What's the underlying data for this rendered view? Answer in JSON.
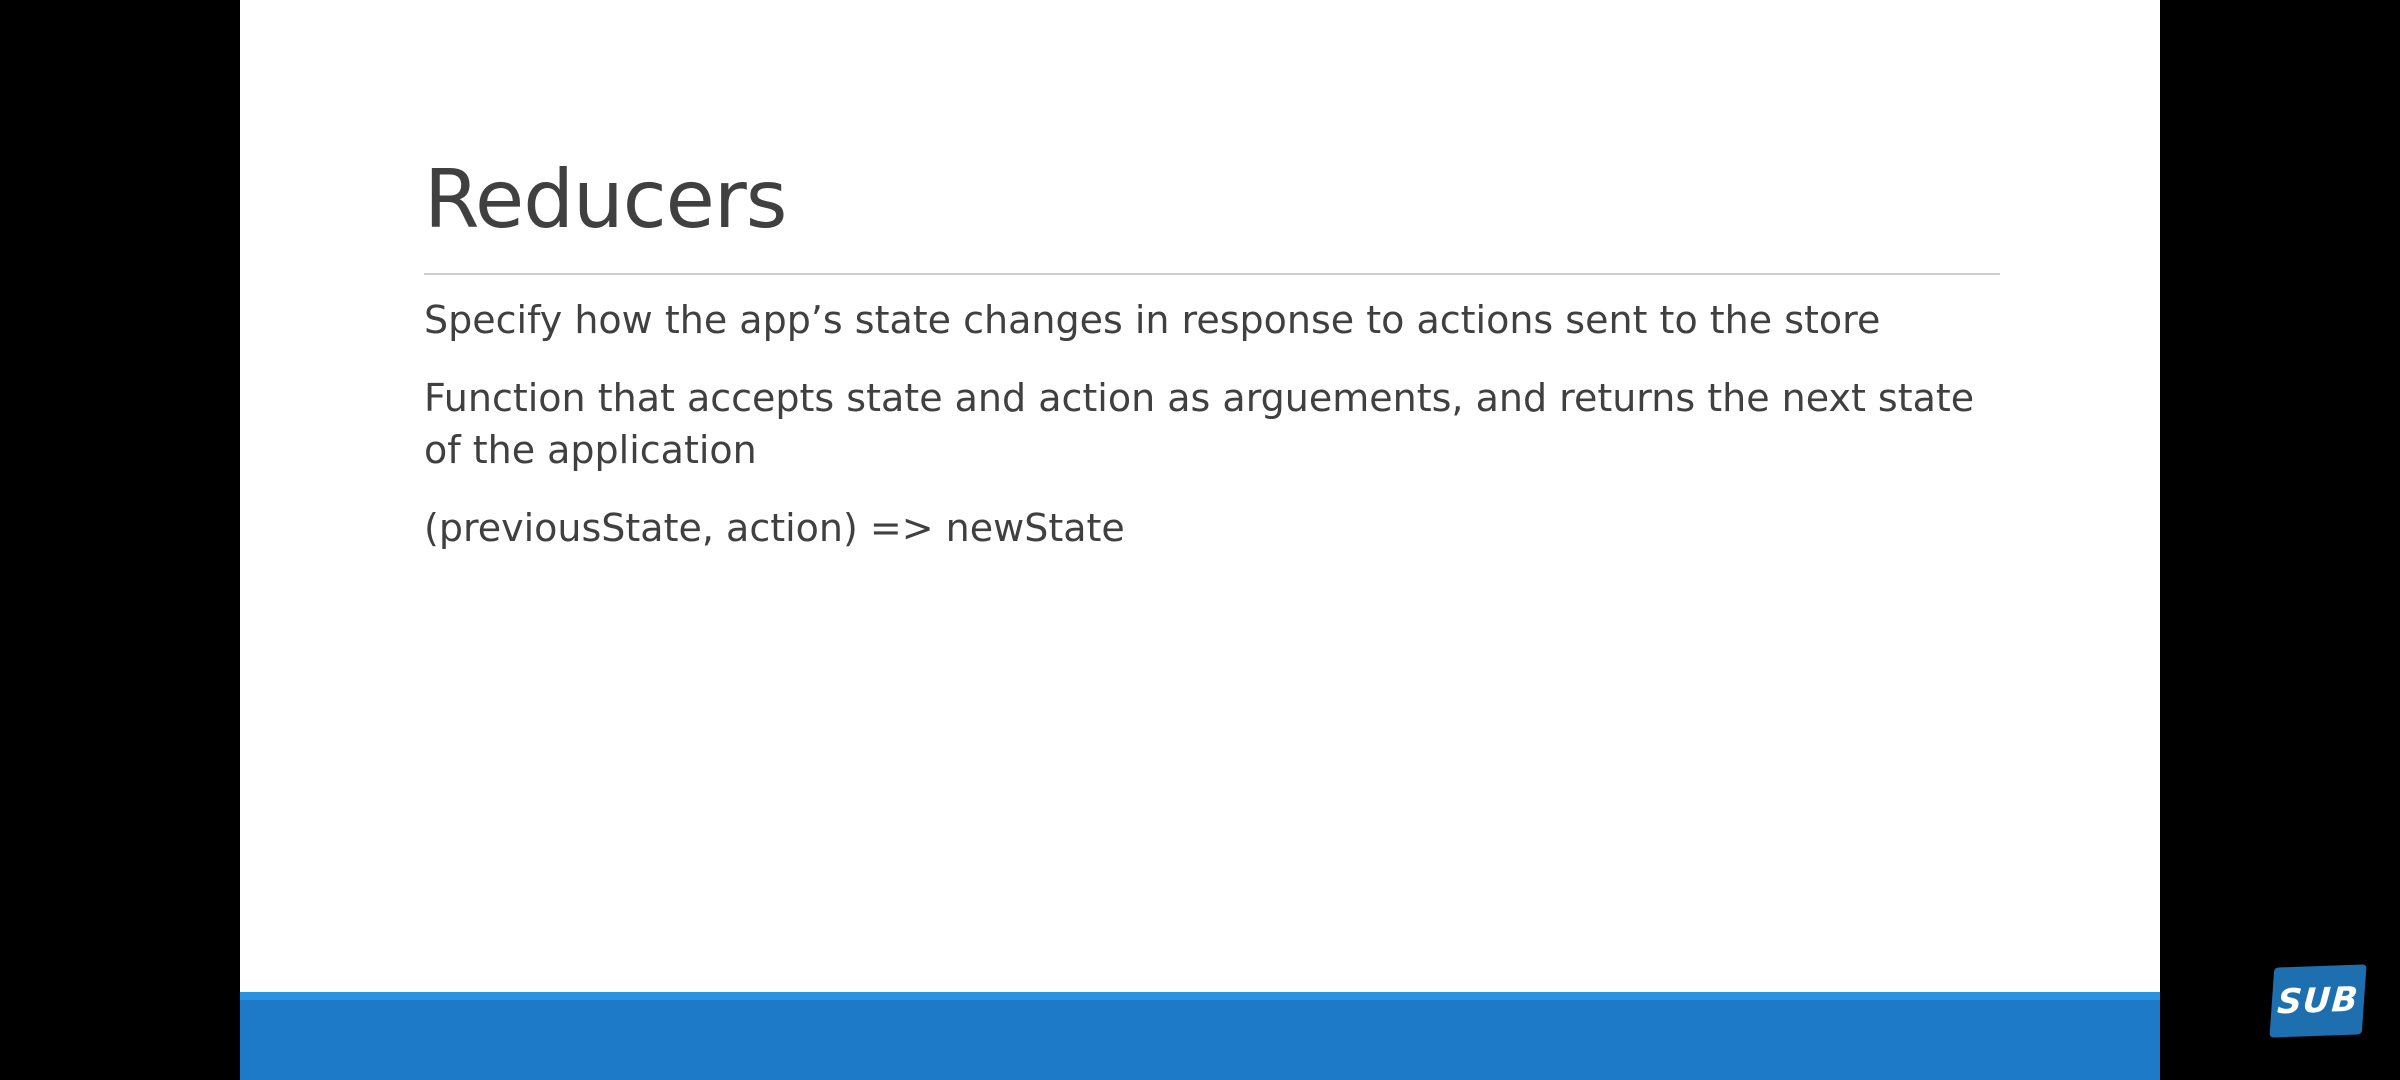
{
  "slide": {
    "title": "Reducers",
    "bullets": [
      "Specify how the app’s state changes in response to actions sent to the store",
      "Function that accepts state and action as arguements, and returns the next state of the application",
      "(previousState, action) => newState"
    ]
  },
  "overlay": {
    "badge_label": "SUB",
    "badge_icon": "subscribe-badge-icon"
  },
  "colors": {
    "letterbox": "#000000",
    "slide_background": "#ffffff",
    "text": "#404040",
    "footer_bar": "#1c7ac9",
    "footer_accent": "#2a93e0",
    "badge": "#1e6fb0"
  }
}
